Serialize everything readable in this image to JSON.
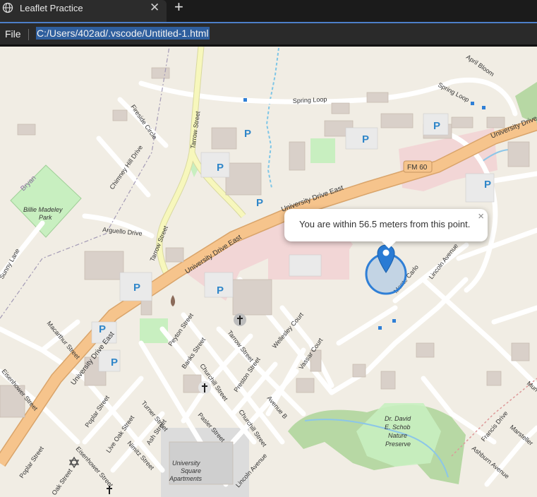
{
  "browser": {
    "tab_title": "Leaflet Practice",
    "tab_close": "✕",
    "new_tab": "+",
    "file_menu": "File",
    "url": "C:/Users/402ad/.vscode/Untitled-1.html"
  },
  "popup": {
    "text": "You are within 56.5 meters from this point.",
    "close": "×"
  },
  "colors": {
    "accuracy_circle": "#2f7fd6",
    "marker": "#2a7bd4",
    "major_road": "#f4c591",
    "tarrow_road": "#f5f5b8",
    "park": "#c8efc0"
  },
  "map_labels": {
    "tarrow_street": "Tarrow Street",
    "spring_loop_1": "Spring Loop",
    "spring_loop_2": "Spring Loop",
    "april_bloom": "April Bloom",
    "fireside_circle": "Fireside Circle",
    "chimney_hill_drive": "Chimney Hill Drive",
    "bryan": "Bryan",
    "billie_madeley_park_1": "Billie Madeley",
    "billie_madeley_park_2": "Park",
    "arguello_drive": "Arguello Drive",
    "university_drive_east_1": "University Drive East",
    "university_drive_east_2": "University Drive East",
    "university_drive_east_3": "University Drive East",
    "university_drive": "University Drive",
    "fm60": "FM 60",
    "sunny_lane": "Sunny Lane",
    "macarthur_street": "Macarthur Street",
    "peyton_street": "Peyton Street",
    "banks_street": "Banks Street",
    "tarrow_street_2": "Tarrow Street",
    "wellesley_court": "Wellesley Court",
    "vassar_court": "Vassar Court",
    "monte_carlo": "Monte Carlo",
    "lincoln_avenue": "Lincoln Avenue",
    "lincoln_avenue_2": "Lincoln Avenue",
    "churchill_street": "Churchill Street",
    "churchill_street_2": "Churchill Street",
    "preston_street": "Preston Street",
    "avenue_b": "Avenue B",
    "eisenhower_street": "Eisenhower Street",
    "eisenhower_street_2": "Eisenhower Street",
    "poplar_street": "Poplar Street",
    "poplar_street_2": "Poplar Street",
    "turner_street": "Turner Street",
    "live_oak_street": "Live Oak Street",
    "ash_street": "Ash Street",
    "nimitz_street": "Nimitz Street",
    "pasler_street": "Pasler Street",
    "oak_street": "Oak Street",
    "university_square_1": "University",
    "university_square_2": "Square",
    "university_square_3": "Apartments",
    "schob_1": "Dr. David",
    "schob_2": "E. Schob",
    "schob_3": "Nature",
    "schob_4": "Preserve",
    "francis_drive": "Francis Drive",
    "ashburn_avenue": "Ashburn Avenue",
    "marsteller": "Marsteller",
    "mun": "Mun",
    "parking": "P"
  },
  "icons": {
    "tab_icon": "globe-icon",
    "church": "church-icon",
    "synagogue": "synagogue-icon",
    "fire_station": "fire-station-icon",
    "location_marker": "map-marker-icon"
  }
}
